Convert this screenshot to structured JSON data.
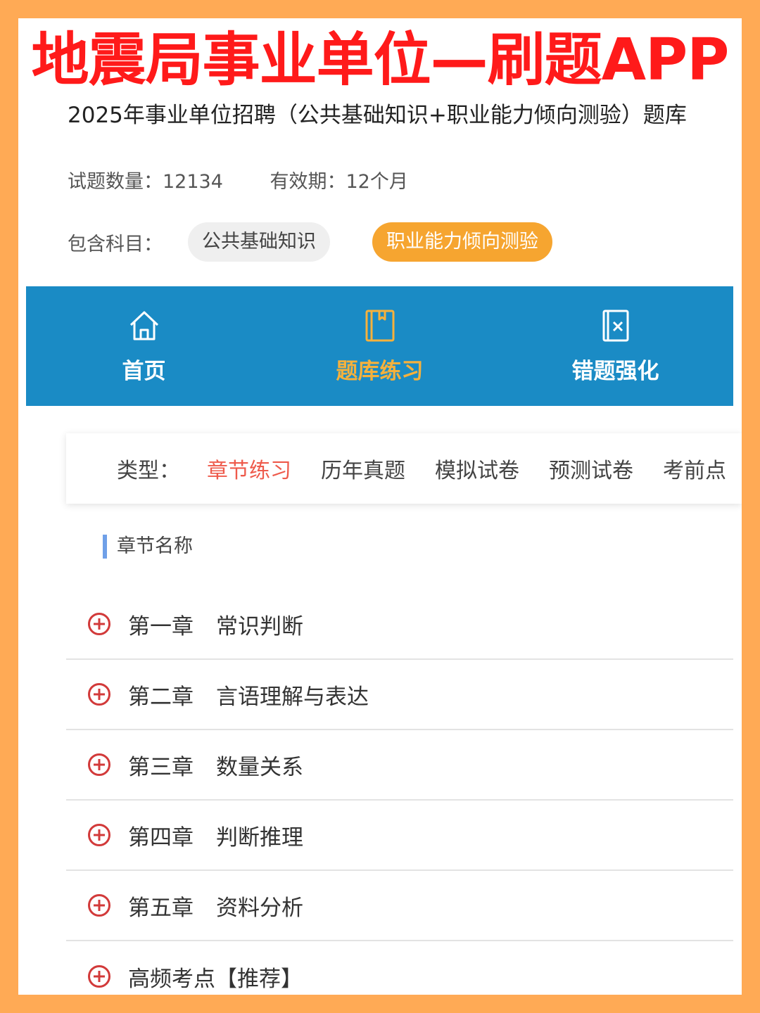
{
  "banner": {
    "title": "地震局事业单位—刷题APP"
  },
  "header": {
    "subtitle": "2025年事业单位招聘（公共基础知识+职业能力倾向测验）题库",
    "question_count": "试题数量：12134",
    "validity": "有效期：12个月",
    "subjects_label": "包含科目：",
    "subjects": [
      "公共基础知识",
      "职业能力倾向测验"
    ]
  },
  "nav": {
    "items": [
      {
        "label": "首页",
        "icon": "home-icon"
      },
      {
        "label": "题库练习",
        "icon": "book-icon"
      },
      {
        "label": "错题强化",
        "icon": "wrong-question-icon"
      }
    ],
    "active_index": 1,
    "color_bg": "#1a8bc5",
    "color_active": "#f6b13c"
  },
  "type_filter": {
    "label": "类型：",
    "items": [
      "章节练习",
      "历年真题",
      "模拟试卷",
      "预测试卷",
      "考前点"
    ],
    "active_index": 0,
    "color_active": "#ee5a4b"
  },
  "section": {
    "title": "章节名称"
  },
  "chapters": [
    {
      "num": "第一章",
      "name": "常识判断"
    },
    {
      "num": "第二章",
      "name": "言语理解与表达"
    },
    {
      "num": "第三章",
      "name": "数量关系"
    },
    {
      "num": "第四章",
      "name": "判断推理"
    },
    {
      "num": "第五章",
      "name": "资料分析"
    },
    {
      "num": "",
      "name": "高频考点【推荐】"
    }
  ],
  "colors": {
    "banner": "#ff1a1a",
    "frame": "#ffaa55",
    "expand_icon": "#d23a3a"
  }
}
